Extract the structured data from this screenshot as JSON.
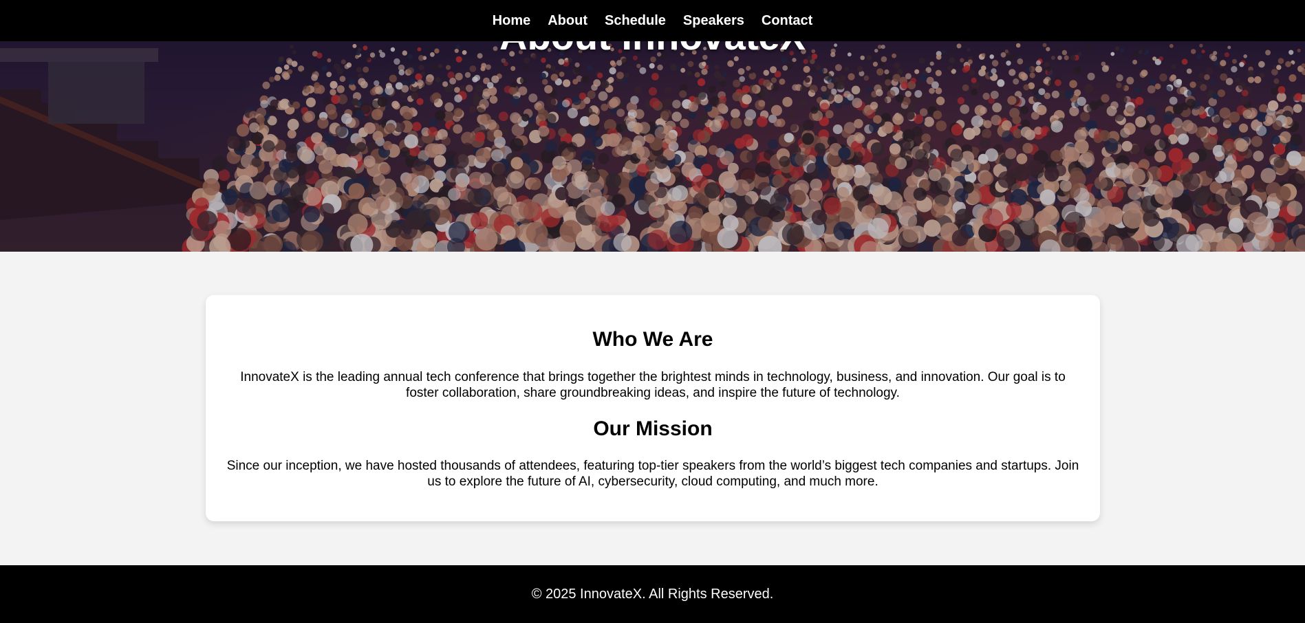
{
  "nav": {
    "items": [
      {
        "label": "Home"
      },
      {
        "label": "About"
      },
      {
        "label": "Schedule"
      },
      {
        "label": "Speakers"
      },
      {
        "label": "Contact"
      }
    ]
  },
  "hero": {
    "title": "About InnovateX"
  },
  "about": {
    "who_title": "Who We Are",
    "who_text": "InnovateX is the leading annual tech conference that brings together the brightest minds in technology, business, and innovation. Our goal is to foster collaboration, share groundbreaking ideas, and inspire the future of technology.",
    "mission_title": "Our Mission",
    "mission_text": "Since our inception, we have hosted thousands of attendees, featuring top-tier speakers from the world’s biggest tech companies and startups. Join us to explore the future of AI, cybersecurity, cloud computing, and much more."
  },
  "footer": {
    "text": "© 2025 InnovateX. All Rights Reserved."
  },
  "colors": {
    "nav_bg": "#000000",
    "page_bg": "#f3f3f3",
    "card_bg": "#ffffff",
    "footer_bg": "#000000"
  }
}
